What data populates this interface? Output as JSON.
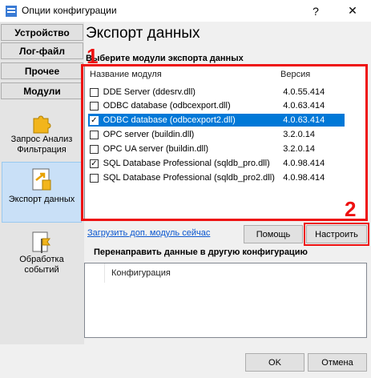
{
  "window": {
    "title": "Опции конфигурации",
    "help_label": "?",
    "close_label": "✕"
  },
  "sidebar": {
    "nav": [
      "Устройство",
      "Лог-файл",
      "Прочее",
      "Модули"
    ],
    "modules": [
      {
        "label": "Запрос Анализ Фильтрация",
        "icon": "puzzle-icon"
      },
      {
        "label": "Экспорт данных",
        "icon": "export-icon",
        "selected": true
      },
      {
        "label": "Обработка событий",
        "icon": "flag-icon"
      }
    ]
  },
  "main": {
    "heading": "Экспорт данных",
    "group_title": "Выберите модули экспорта данных",
    "table": {
      "headers": [
        "Название модуля",
        "Версия"
      ],
      "rows": [
        {
          "name": "DDE Server (ddesrv.dll)",
          "version": "4.0.55.414",
          "checked": false
        },
        {
          "name": "ODBC database (odbcexport.dll)",
          "version": "4.0.63.414",
          "checked": false
        },
        {
          "name": "ODBC database (odbcexport2.dll)",
          "version": "4.0.63.414",
          "checked": true,
          "selected": true
        },
        {
          "name": "OPC server (buildin.dll)",
          "version": "3.2.0.14",
          "checked": false
        },
        {
          "name": "OPC UA server (buildin.dll)",
          "version": "3.2.0.14",
          "checked": false
        },
        {
          "name": "SQL Database Professional (sqldb_pro.dll)",
          "version": "4.0.98.414",
          "checked": true
        },
        {
          "name": "SQL Database Professional (sqldb_pro2.dll)",
          "version": "4.0.98.414",
          "checked": false
        }
      ]
    },
    "annotations": [
      "1",
      "2"
    ],
    "load_link": "Загрузить доп. модуль сейчас",
    "help_button": "Помощь",
    "configure_button": "Настроить",
    "redirect_title": "Перенаправить данные в другую конфигурацию",
    "redirect_header": "Конфигурация"
  },
  "footer": {
    "ok": "OK",
    "cancel": "Отмена"
  },
  "colors": {
    "selection": "#0078d7",
    "annotation_red": "#e11111",
    "link": "#0b57d0"
  }
}
